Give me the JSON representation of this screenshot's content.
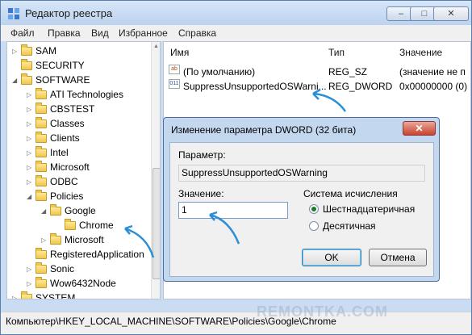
{
  "window": {
    "title": "Редактор реестра"
  },
  "window_buttons": {
    "minimize": "–",
    "maximize": "□",
    "close": "✕"
  },
  "menu": [
    "Файл",
    "Правка",
    "Вид",
    "Избранное",
    "Справка"
  ],
  "tree": [
    {
      "label": "SAM"
    },
    {
      "label": "SECURITY"
    },
    {
      "label": "SOFTWARE"
    },
    {
      "label": "ATI Technologies"
    },
    {
      "label": "CBSTEST"
    },
    {
      "label": "Classes"
    },
    {
      "label": "Clients"
    },
    {
      "label": "Intel"
    },
    {
      "label": "Microsoft"
    },
    {
      "label": "ODBC"
    },
    {
      "label": "Policies"
    },
    {
      "label": "Google"
    },
    {
      "label": "Chrome"
    },
    {
      "label": "Microsoft"
    },
    {
      "label": "RegisteredApplication"
    },
    {
      "label": "Sonic"
    },
    {
      "label": "Wow6432Node"
    },
    {
      "label": "SYSTEM"
    }
  ],
  "list": {
    "headers": {
      "name": "Имя",
      "type": "Тип",
      "value": "Значение"
    },
    "rows": [
      {
        "icon": "ab",
        "name": "(По умолчанию)",
        "type": "REG_SZ",
        "value": "(значение не п"
      },
      {
        "icon": "011",
        "name": "SuppressUnsupportedOSWarni...",
        "type": "REG_DWORD",
        "value": "0x00000000 (0)"
      }
    ]
  },
  "status": "Компьютер\\HKEY_LOCAL_MACHINE\\SOFTWARE\\Policies\\Google\\Chrome",
  "dialog": {
    "title": "Изменение параметра DWORD (32 бита)",
    "close": "✕",
    "param_label": "Параметр:",
    "param_value": "SuppressUnsupportedOSWarning",
    "value_label": "Значение:",
    "value_text": "1",
    "system_label": "Система исчисления",
    "radio_hex": "Шестнадцатеричная",
    "radio_dec": "Десятичная",
    "ok": "OK",
    "cancel": "Отмена"
  },
  "watermark": "REMONTKA.COM",
  "colors": {
    "arrow": "#2a8fd6",
    "accent": "#c3d7ef"
  }
}
